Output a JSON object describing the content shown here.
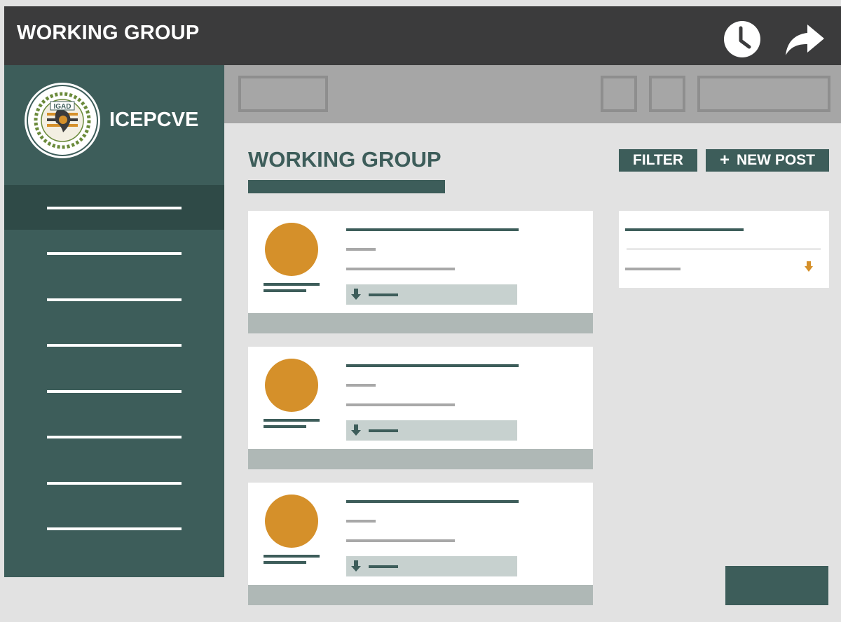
{
  "app": {
    "title": "WORKING GROUP",
    "history_icon": "clock-icon",
    "share_icon": "share-arrow-icon"
  },
  "sidebar": {
    "org_name": "ICEPCVE",
    "logo_text": "IGAD",
    "nav_item_count": 8,
    "active_index": 0
  },
  "main": {
    "title": "WORKING GROUP",
    "filter_label": "FILTER",
    "new_post_label": "NEW POST",
    "new_post_icon": "plus-icon",
    "post_count": 3
  },
  "colors": {
    "topbar": "#3b3b3c",
    "sidebar": "#3d5d5a",
    "sidebar_active": "#2f4a47",
    "accent": "#d5902a",
    "toolbar": "#a6a6a6",
    "background": "#e2e2e2"
  }
}
